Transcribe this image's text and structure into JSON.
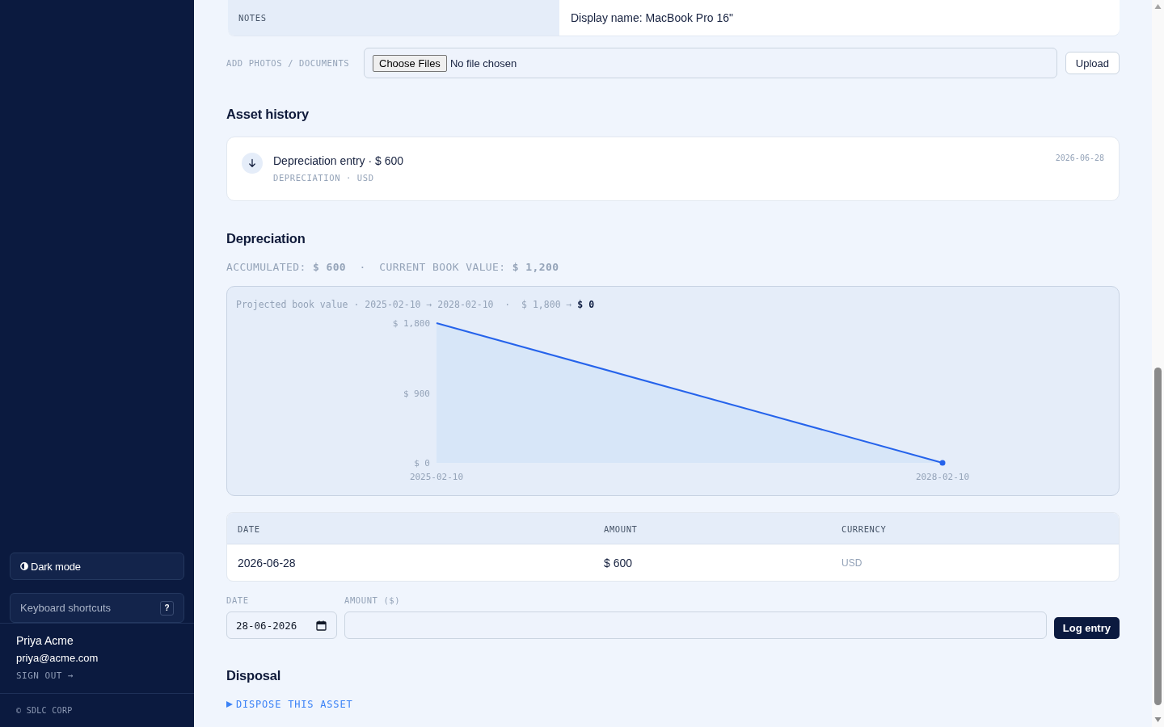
{
  "sidebar": {
    "dark_mode_button": {
      "label": "Dark mode"
    },
    "shortcuts_button": {
      "label": "Keyboard shortcuts",
      "key": "?"
    },
    "user": {
      "name": "Priya Acme",
      "email": "priya@acme.com",
      "sign_out": "SIGN OUT →"
    },
    "footer": "© SDLC CORP"
  },
  "details": {
    "rows": [
      {
        "label": "NOTES",
        "value": "Display name: MacBook Pro 16\""
      }
    ]
  },
  "upload": {
    "label": "ADD PHOTOS / DOCUMENTS",
    "choose_button": "Choose Files",
    "file_status": "No file chosen",
    "upload_button": "Upload"
  },
  "asset_history": {
    "title": "Asset history",
    "entries": [
      {
        "title": "Depreciation entry · $ 600",
        "meta": "DEPRECIATION · USD",
        "date": "2026-06-28"
      }
    ]
  },
  "depreciation": {
    "title": "Depreciation",
    "summary": "ACCUMULATED: **$ 600**  ·  CURRENT BOOK VALUE: **$ 1,200**",
    "chart_data": {
      "type": "area",
      "title": "Projected book value · 2025-02-10 → 2028-02-10  ·  $ 1,800 → **$ 0**",
      "x": [
        "2025-02-10",
        "2028-02-10"
      ],
      "values": [
        1800,
        0
      ],
      "ylim": [
        0,
        1800
      ],
      "yticks": [
        {
          "value": 0,
          "label": "$ 0"
        },
        {
          "value": 900,
          "label": "$ 900"
        },
        {
          "value": 1800,
          "label": "$ 1,800"
        }
      ]
    },
    "table": {
      "columns": [
        "DATE",
        "AMOUNT",
        "CURRENCY"
      ],
      "rows": [
        [
          "2026-06-28",
          "$ 600",
          "USD"
        ]
      ]
    },
    "form": {
      "date_label": "DATE",
      "date_value": "28-06-2026",
      "amount_label": "AMOUNT ($)",
      "submit": "Log entry"
    }
  },
  "disposal": {
    "title": "Disposal",
    "toggle": {
      "label": "DISPOSE THIS ASSET",
      "expanded": false
    }
  }
}
